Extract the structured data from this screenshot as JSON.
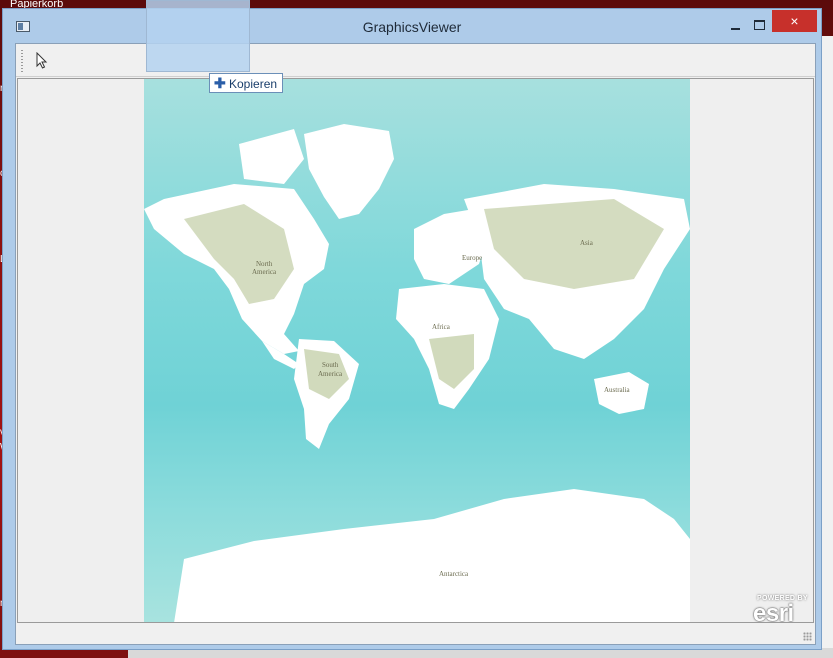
{
  "desktop": {
    "recycle_bin_label": "Papierkorb",
    "side_fragments": [
      "re",
      "c",
      "LC",
      "ve",
      "W",
      "nn"
    ]
  },
  "window": {
    "title": "GraphicsViewer",
    "buttons": {
      "minimize": "minimize-icon",
      "maximize": "maximize-icon",
      "close": "×"
    }
  },
  "toolbar": {
    "tools": [
      {
        "name": "pointer-tool",
        "icon": "cursor-arrow-icon"
      }
    ]
  },
  "drag": {
    "tooltip_label": "Kopieren",
    "tooltip_icon": "plus-icon"
  },
  "map": {
    "labels": {
      "north_america": [
        "North",
        "America"
      ],
      "south_america": [
        "South",
        "America"
      ],
      "europe": "Europe",
      "asia": "Asia",
      "africa": "Africa",
      "australia": "Australia",
      "antarctica": "Antarctica"
    },
    "attribution": {
      "powered_by": "POWERED BY",
      "brand": "esri"
    },
    "colors": {
      "ocean": "#7fd7d9",
      "land": "#ffffff",
      "vegetation": "#c9d3b0"
    }
  }
}
